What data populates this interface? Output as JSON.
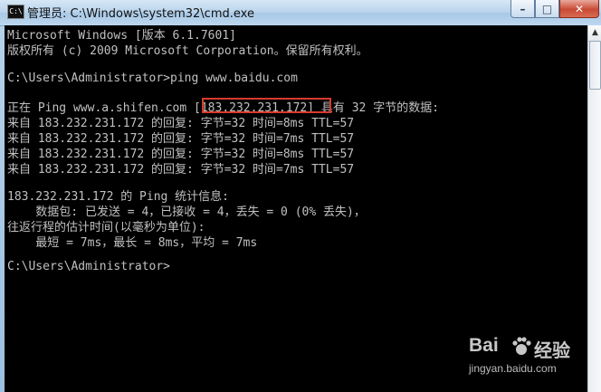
{
  "window": {
    "title": "管理员: C:\\Windows\\system32\\cmd.exe",
    "icon_label": "C:\\",
    "icon_name": "cmd-app-icon",
    "controls": {
      "minimize": "–",
      "maximize": "□",
      "close": "✕"
    }
  },
  "console": {
    "lines": [
      "Microsoft Windows [版本 6.1.7601]",
      "版权所有 (c) 2009 Microsoft Corporation。保留所有权利。",
      "",
      "C:\\Users\\Administrator>ping www.baidu.com",
      "",
      "正在 Ping www.a.shifen.com [183.232.231.172] 具有 32 字节的数据:",
      "来自 183.232.231.172 的回复: 字节=32 时间=8ms TTL=57",
      "来自 183.232.231.172 的回复: 字节=32 时间=7ms TTL=57",
      "来自 183.232.231.172 的回复: 字节=32 时间=8ms TTL=57",
      "来自 183.232.231.172 的回复: 字节=32 时间=7ms TTL=57",
      "",
      "183.232.231.172 的 Ping 统计信息:",
      "    数据包: 已发送 = 4，已接收 = 4，丢失 = 0 (0% 丢失)，",
      "往返行程的估计时间(以毫秒为单位):",
      "    最短 = 7ms，最长 = 8ms，平均 = 7ms",
      "",
      "C:\\Users\\Administrator>"
    ],
    "highlighted_text": "[183.232.231.172]"
  },
  "scrollbar": {
    "up_arrow": "▲"
  },
  "watermark": {
    "logo_text": "Bai",
    "logo_text2": "经验",
    "url": "jingyan.baidu.com"
  },
  "colors": {
    "console_bg": "#000000",
    "console_fg": "#c0c0c0",
    "highlight_border": "#d83a2d"
  }
}
